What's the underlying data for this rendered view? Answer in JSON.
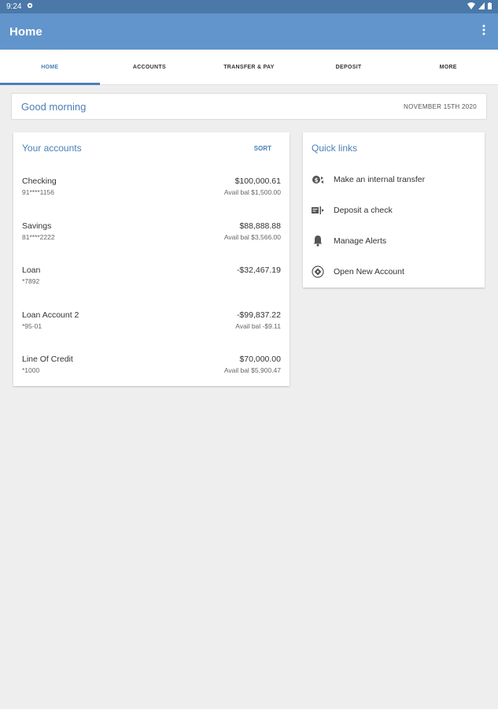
{
  "status": {
    "time": "9:24"
  },
  "appbar": {
    "title": "Home"
  },
  "tabs": [
    {
      "label": "HOME"
    },
    {
      "label": "ACCOUNTS"
    },
    {
      "label": "TRANSFER & PAY"
    },
    {
      "label": "DEPOSIT"
    },
    {
      "label": "MORE"
    }
  ],
  "greeting": {
    "text": "Good morning",
    "date": "NOVEMBER 15TH 2020"
  },
  "accounts": {
    "title": "Your accounts",
    "sort_label": "SORT",
    "items": [
      {
        "name": "Checking",
        "number": "91****1156",
        "amount": "$100,000.61",
        "avail": "Avail bal $1,500.00"
      },
      {
        "name": "Savings",
        "number": "81****2222",
        "amount": "$88,888.88",
        "avail": "Avail bal $3,566.00"
      },
      {
        "name": "Loan",
        "number": "*7892",
        "amount": "-$32,467.19",
        "avail": ""
      },
      {
        "name": "Loan Account 2",
        "number": "*95-01",
        "amount": "-$99,837.22",
        "avail": "Avail bal -$9.11"
      },
      {
        "name": "Line Of Credit",
        "number": "*1000",
        "amount": "$70,000.00",
        "avail": "Avail bal $5,900.47"
      }
    ]
  },
  "quick_links": {
    "title": "Quick links",
    "items": [
      {
        "label": "Make an internal transfer",
        "icon": "transfer-icon"
      },
      {
        "label": "Deposit a check",
        "icon": "check-deposit-icon"
      },
      {
        "label": "Manage Alerts",
        "icon": "bell-icon"
      },
      {
        "label": "Open New Account",
        "icon": "open-account-icon"
      }
    ]
  },
  "colors": {
    "accent": "#4a7fb8",
    "appbar": "#6195cb",
    "statusbar": "#4a78a8"
  }
}
